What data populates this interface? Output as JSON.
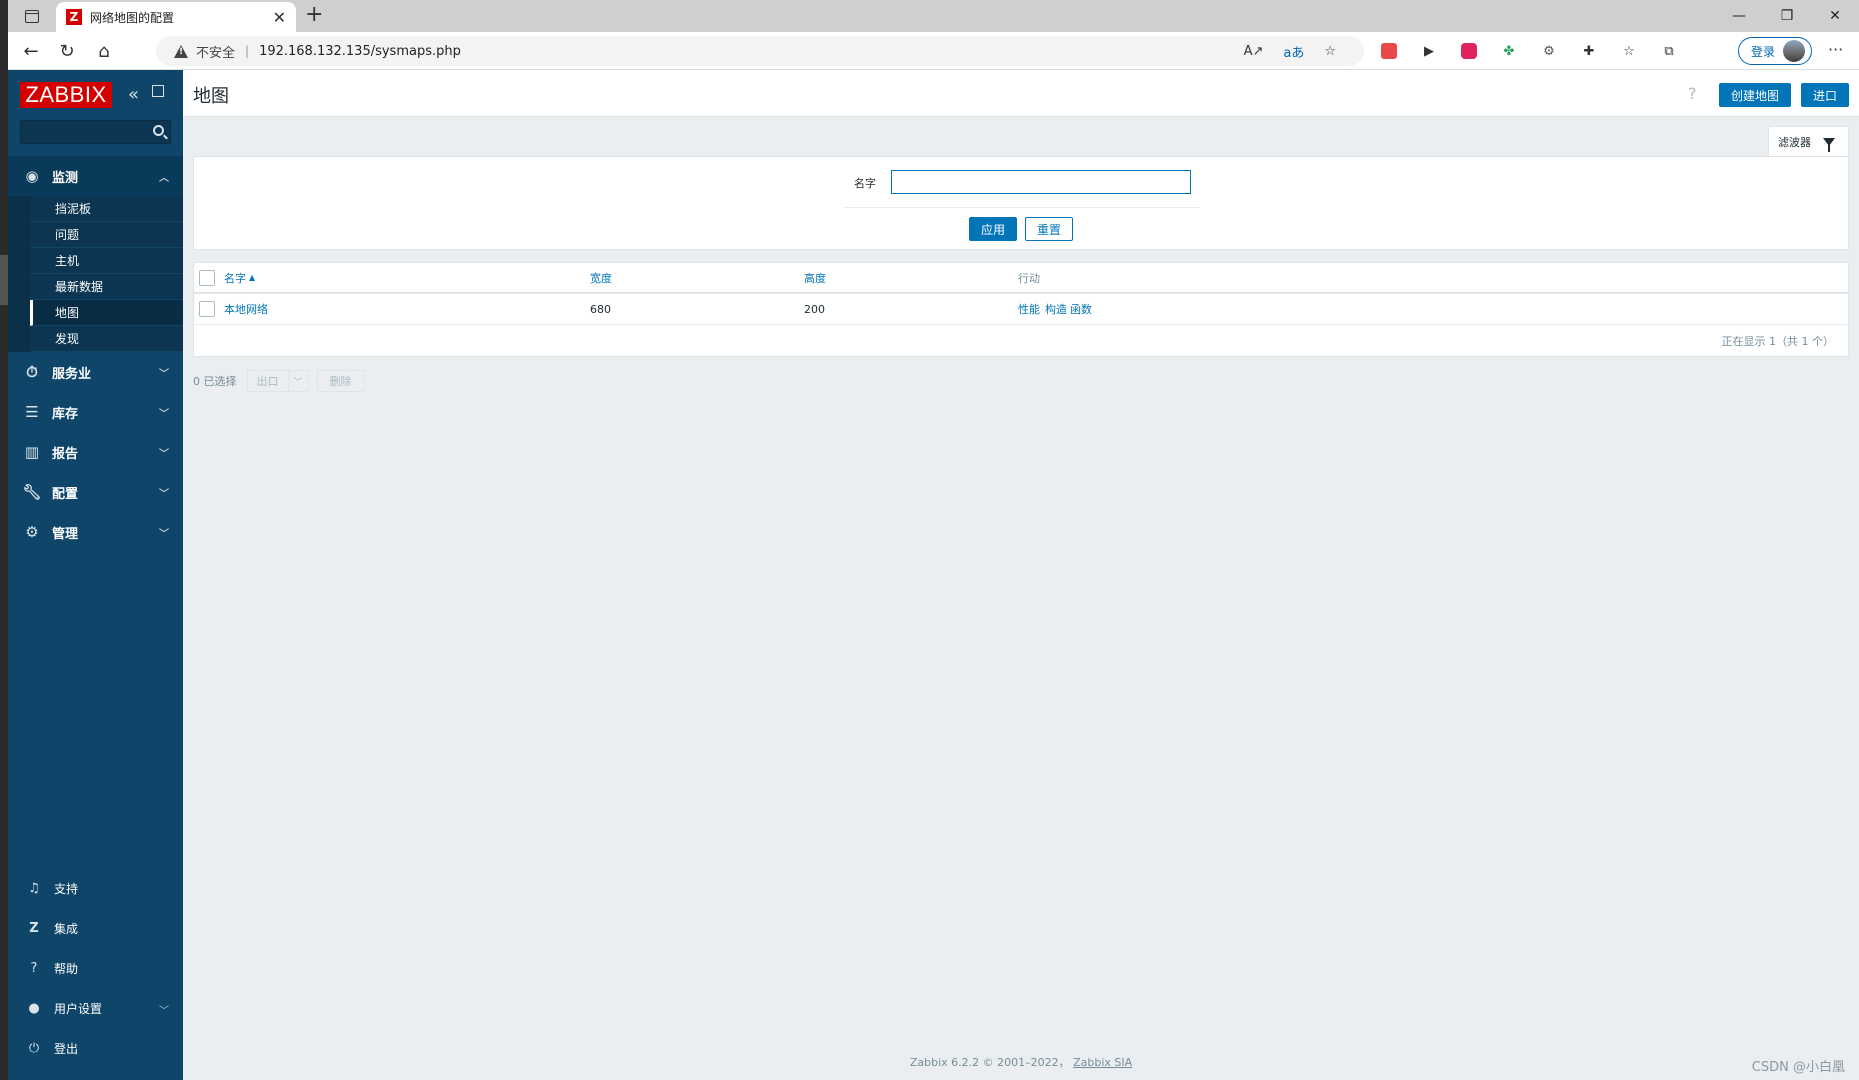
{
  "browser": {
    "tab_title": "网络地图的配置",
    "tab_favicon": "Z",
    "insecure_label": "不安全",
    "url": "192.168.132.135/sysmaps.php",
    "login_label": "登录",
    "window_controls": [
      "—",
      "❐",
      "✕"
    ]
  },
  "sidebar": {
    "logo": "ZABBIX",
    "sections": {
      "monitor": "监测",
      "services": "服务业",
      "inventory": "库存",
      "reports": "报告",
      "config": "配置",
      "admin": "管理"
    },
    "monitor_items": [
      "挡泥板",
      "问题",
      "主机",
      "最新数据",
      "地图",
      "发现"
    ],
    "active_item": "地图",
    "footer": {
      "support": "支持",
      "integrations": "集成",
      "help": "帮助",
      "user_settings": "用户设置",
      "logout": "登出"
    }
  },
  "header": {
    "title": "地图",
    "help": "?",
    "create_map": "创建地图",
    "import": "进口"
  },
  "filter": {
    "tab_label": "滤波器",
    "name_label": "名字",
    "name_value": "",
    "apply": "应用",
    "reset": "重置"
  },
  "table": {
    "columns": {
      "name": "名字",
      "width": "宽度",
      "height": "高度",
      "actions": "行动"
    },
    "rows": [
      {
        "name": "本地网络",
        "width": "680",
        "height": "200",
        "action_properties": "性能",
        "action_constructor": "构造",
        "action_functions": "函数"
      }
    ],
    "footer": "正在显示 1（共 1 个）"
  },
  "selection": {
    "count_label": "0 已选择",
    "export": "出口",
    "delete": "删除"
  },
  "page_footer": {
    "text": "Zabbix 6.2.2 © 2001–2022，",
    "company": "Zabbix SIA"
  },
  "watermark": "CSDN @小白凰"
}
